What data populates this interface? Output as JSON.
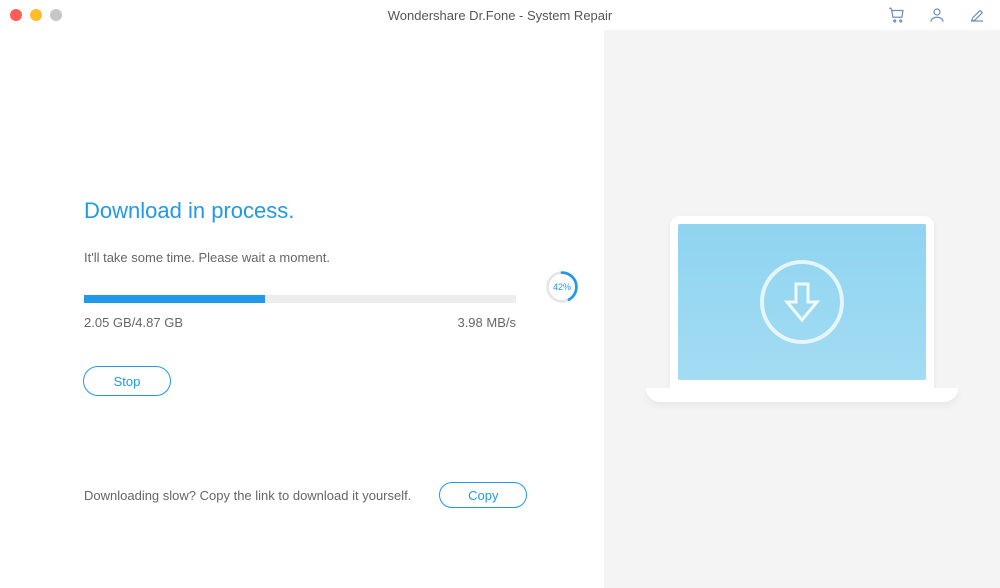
{
  "titlebar": {
    "title": "Wondershare Dr.Fone - System Repair"
  },
  "main": {
    "heading": "Download in process.",
    "subtext": "It'll take some time. Please wait a moment.",
    "progress": {
      "percent": 42,
      "percent_label": "42%",
      "downloaded": "2.05 GB/4.87 GB",
      "speed": "3.98 MB/s"
    },
    "stop_label": "Stop"
  },
  "footer": {
    "prompt": "Downloading slow? Copy the link to download it yourself.",
    "copy_label": "Copy"
  },
  "colors": {
    "accent": "#2199e8"
  }
}
